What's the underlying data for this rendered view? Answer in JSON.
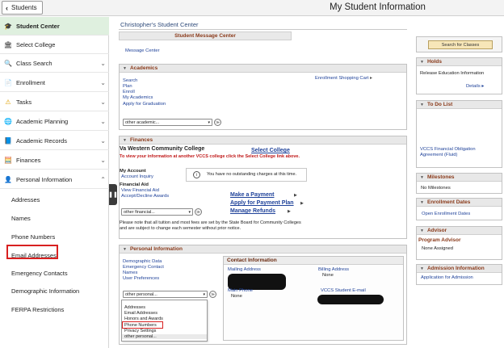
{
  "topbar": {
    "back_label": "Students",
    "title": "My Student Information"
  },
  "sidebar": {
    "items": [
      {
        "label": "Student Center",
        "icon": "🎓"
      },
      {
        "label": "Select College",
        "icon": "🏛"
      },
      {
        "label": "Class Search",
        "icon": "🔍"
      },
      {
        "label": "Enrollment",
        "icon": "📄"
      },
      {
        "label": "Tasks",
        "icon": "⚠"
      },
      {
        "label": "Academic Planning",
        "icon": "🌐"
      },
      {
        "label": "Academic Records",
        "icon": "📘"
      },
      {
        "label": "Finances",
        "icon": "🧮"
      },
      {
        "label": "Personal Information",
        "icon": "👤"
      }
    ],
    "sub_items": [
      "Addresses",
      "Names",
      "Phone Numbers",
      "Email Addresses",
      "Emergency Contacts",
      "Demographic Information",
      "FERPA Restrictions"
    ]
  },
  "main": {
    "title": "Christopher's Student Center",
    "message_center": {
      "heading": "Student Message Center",
      "link": "Message Center"
    },
    "academics": {
      "heading": "Academics",
      "links": [
        "Search",
        "Plan",
        "Enroll",
        "My Academics",
        "Apply for Graduation"
      ],
      "cart_link": "Enrollment Shopping Cart",
      "select": "other academic..."
    },
    "finances": {
      "heading": "Finances",
      "college": "Va Western Community College",
      "select_college": "Select College",
      "notice": "To view your information at another VCCS college click the Select College link above.",
      "my_account": "My Account",
      "account_inquiry": "Account Inquiry",
      "financial_aid": "Financial Aid",
      "view_aid": "View Financial Aid",
      "accept_awards": "Accept/Decline Awards",
      "no_charges": "You have no outstanding charges at this time.",
      "make_payment": "Make a Payment",
      "apply_plan": "Apply for Payment Plan",
      "manage_refunds": "Manage Refunds",
      "select": "other financial...",
      "note": "Please note that all tuition and most fees are set by the State Board for Community Colleges and are subject to change each semester without prior notice."
    },
    "personal": {
      "heading": "Personal Information",
      "links": [
        "Demographic Data",
        "Emergency Contact",
        "Names",
        "User Preferences"
      ],
      "contact_heading": "Contact Information",
      "mailing_address": "Mailing Address",
      "billing_address": "Billing Address",
      "billing_value": "None",
      "main_phone": "Main Phone",
      "main_phone_value": "None",
      "student_email": "VCCS Student E-mail",
      "select": "other personal...",
      "dropdown_options": [
        "Addresses",
        "Email Addresses",
        "Honors and Awards",
        "Phone Numbers",
        "Privacy Settings",
        "other personal..."
      ]
    }
  },
  "right": {
    "search_classes": "Search for Classes",
    "holds": {
      "heading": "Holds",
      "item": "Release Education Information",
      "details": "Details"
    },
    "todo": {
      "heading": "To Do List",
      "item": "VCCS Financial Obligation Agreement (Fluid)"
    },
    "milestones": {
      "heading": "Milestones",
      "item": "No Milestones"
    },
    "enrollment_dates": {
      "heading": "Enrollment Dates",
      "item": "Open Enrollment Dates"
    },
    "advisor": {
      "heading": "Advisor",
      "program_advisor": "Program Advisor",
      "value": "None Assigned"
    },
    "admission": {
      "heading": "Admission Information",
      "item": "Application for Admission"
    }
  }
}
